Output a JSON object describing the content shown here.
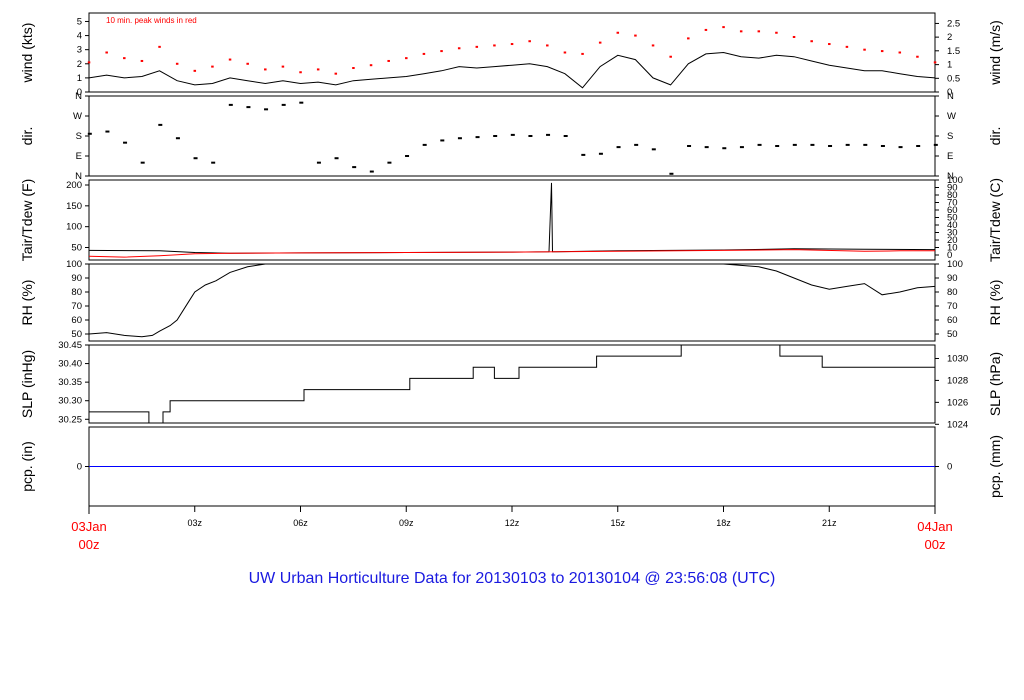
{
  "title": "UW Urban Horticulture Data for 20130103  to  20130104 @ 23:56:08  (UTC)",
  "colors": {
    "line": "#000000",
    "peak": "#ff0000",
    "dew": "#ff0000",
    "precip": "#0000ff",
    "title": "#1a1ae0",
    "endlabel": "#ff0000"
  },
  "x_axis": {
    "range_hours": [
      0,
      24
    ],
    "ticks": [
      {
        "h": 3,
        "label": "03z"
      },
      {
        "h": 6,
        "label": "06z"
      },
      {
        "h": 9,
        "label": "09z"
      },
      {
        "h": 12,
        "label": "12z"
      },
      {
        "h": 15,
        "label": "15z"
      },
      {
        "h": 18,
        "label": "18z"
      },
      {
        "h": 21,
        "label": "21z"
      }
    ],
    "start": {
      "line1": "03Jan",
      "line2": "00z"
    },
    "end": {
      "line1": "04Jan",
      "line2": "00z"
    }
  },
  "chart_data": [
    {
      "id": "wind",
      "type": "line",
      "ylabel": "wind (kts)",
      "ylabel_right": "wind (m/s)",
      "ylim": [
        0,
        5.6
      ],
      "yticks": [
        "0",
        "1",
        "2",
        "3",
        "4",
        "5"
      ],
      "yticks_right": [
        {
          "v": 0,
          "label": "0"
        },
        {
          "v": 0.97,
          "label": "0.5"
        },
        {
          "v": 1.94,
          "label": "1"
        },
        {
          "v": 2.92,
          "label": "1.5"
        },
        {
          "v": 3.89,
          "label": "2"
        },
        {
          "v": 4.86,
          "label": "2.5"
        }
      ],
      "annotation": "10 min. peak winds in red",
      "series": [
        {
          "name": "wind",
          "x": [
            0,
            0.5,
            1,
            1.5,
            2,
            2.5,
            3,
            3.5,
            4,
            4.5,
            5,
            5.5,
            6,
            6.5,
            7,
            7.5,
            8,
            8.5,
            9,
            9.5,
            10,
            10.5,
            11,
            11.5,
            12,
            12.5,
            13,
            13.5,
            14,
            14.5,
            15,
            15.5,
            16,
            16.5,
            17,
            17.5,
            18,
            18.5,
            19,
            19.5,
            20,
            20.5,
            21,
            21.5,
            22,
            22.5,
            23,
            23.5,
            24
          ],
          "values": [
            1,
            1.2,
            1,
            1.1,
            1.5,
            0.8,
            0.5,
            0.6,
            1,
            0.8,
            0.6,
            0.8,
            0.6,
            0.7,
            0.5,
            0.8,
            0.9,
            1,
            1.1,
            1.3,
            1.5,
            1.8,
            1.7,
            1.8,
            1.9,
            2,
            1.8,
            1.3,
            0.3,
            1.8,
            2.6,
            2.3,
            1,
            0.5,
            2,
            2.7,
            2.8,
            2.5,
            2.4,
            2.6,
            2.5,
            2.2,
            1.9,
            1.7,
            1.5,
            1.5,
            1.3,
            1.1,
            1
          ]
        },
        {
          "name": "peak",
          "x": [
            0,
            0.5,
            1,
            1.5,
            2,
            2.5,
            3,
            3.5,
            4,
            4.5,
            5,
            5.5,
            6,
            6.5,
            7,
            7.5,
            8,
            8.5,
            9,
            9.5,
            10,
            10.5,
            11,
            11.5,
            12,
            12.5,
            13,
            13.5,
            14,
            14.5,
            15,
            15.5,
            16,
            16.5,
            17,
            17.5,
            18,
            18.5,
            19,
            19.5,
            20,
            20.5,
            21,
            21.5,
            22,
            22.5,
            23,
            23.5,
            24
          ],
          "values": [
            2.1,
            2.8,
            2.4,
            2.2,
            3.2,
            2,
            1.5,
            1.8,
            2.3,
            2,
            1.6,
            1.8,
            1.4,
            1.6,
            1.3,
            1.7,
            1.9,
            2.2,
            2.4,
            2.7,
            2.9,
            3.1,
            3.2,
            3.3,
            3.4,
            3.6,
            3.3,
            2.8,
            2.7,
            3.5,
            4.2,
            4,
            3.3,
            2.5,
            3.8,
            4.4,
            4.6,
            4.3,
            4.3,
            4.2,
            3.9,
            3.6,
            3.4,
            3.2,
            3,
            2.9,
            2.8,
            2.5,
            2.1
          ]
        }
      ]
    },
    {
      "id": "dir",
      "type": "scatter",
      "ylabel": "dir.",
      "ylabel_right": "dir.",
      "ylim": [
        0,
        360
      ],
      "yticks": [
        {
          "v": 0,
          "label": "N"
        },
        {
          "v": 90,
          "label": "E"
        },
        {
          "v": 180,
          "label": "S"
        },
        {
          "v": 270,
          "label": "W"
        },
        {
          "v": 360,
          "label": "N"
        }
      ],
      "series": [
        {
          "name": "direction",
          "x": [
            0,
            0.5,
            1,
            1.5,
            2,
            2.5,
            3,
            3.5,
            4,
            4.5,
            5,
            5.5,
            6,
            6.5,
            7,
            7.5,
            8,
            8.5,
            9,
            9.5,
            10,
            10.5,
            11,
            11.5,
            12,
            12.5,
            13,
            13.5,
            14,
            14.5,
            15,
            15.5,
            16,
            16.5,
            17,
            17.5,
            18,
            18.5,
            19,
            19.5,
            20,
            20.5,
            21,
            21.5,
            22,
            22.5,
            23,
            23.5,
            24
          ],
          "values": [
            190,
            200,
            150,
            60,
            230,
            170,
            80,
            60,
            320,
            310,
            300,
            320,
            330,
            60,
            80,
            40,
            20,
            60,
            90,
            140,
            160,
            170,
            175,
            180,
            185,
            180,
            185,
            180,
            95,
            100,
            130,
            140,
            120,
            10,
            135,
            130,
            125,
            130,
            140,
            135,
            140,
            140,
            135,
            140,
            140,
            135,
            130,
            135,
            140
          ]
        }
      ]
    },
    {
      "id": "temp",
      "type": "line",
      "ylabel": "Tair/Tdew (F)",
      "ylabel_right": "Tair/Tdew (C)",
      "ylim": [
        20,
        212
      ],
      "yticks": [
        "50",
        "100",
        "150",
        "200"
      ],
      "yticks_right": [
        {
          "v": 32,
          "label": "0"
        },
        {
          "v": 50,
          "label": "10"
        },
        {
          "v": 68,
          "label": "20"
        },
        {
          "v": 86,
          "label": "30"
        },
        {
          "v": 104,
          "label": "40"
        },
        {
          "v": 122,
          "label": "50"
        },
        {
          "v": 140,
          "label": "60"
        },
        {
          "v": 158,
          "label": "70"
        },
        {
          "v": 176,
          "label": "80"
        },
        {
          "v": 194,
          "label": "90"
        },
        {
          "v": 212,
          "label": "100"
        }
      ],
      "series": [
        {
          "name": "Tair",
          "x": [
            0,
            2,
            3,
            4,
            6,
            9,
            12,
            13.05,
            13.12,
            13.15,
            13.25,
            15,
            18,
            20,
            22,
            24
          ],
          "values": [
            43,
            42,
            38,
            36,
            37,
            38,
            39,
            40,
            205,
            40,
            40,
            42,
            44,
            47,
            46,
            45
          ]
        },
        {
          "name": "Tdew",
          "x": [
            0,
            1,
            2,
            3,
            4,
            6,
            9,
            12,
            15,
            18,
            20,
            22,
            23,
            24
          ],
          "values": [
            29,
            27,
            30,
            35,
            36,
            37,
            38,
            39,
            41,
            43,
            45,
            41,
            42,
            42
          ]
        }
      ]
    },
    {
      "id": "rh",
      "type": "line",
      "ylabel": "RH (%)",
      "ylabel_right": "RH (%)",
      "ylim": [
        45,
        100
      ],
      "yticks": [
        "50",
        "60",
        "70",
        "80",
        "90",
        "100"
      ],
      "series": [
        {
          "name": "RH",
          "x": [
            0,
            0.5,
            1,
            1.5,
            1.8,
            2,
            2.3,
            2.5,
            2.8,
            3,
            3.3,
            3.6,
            4,
            4.5,
            5,
            10,
            15,
            18,
            18.5,
            19,
            19.5,
            20,
            20.5,
            21,
            21.5,
            22,
            22.5,
            23,
            23.5,
            24
          ],
          "values": [
            50,
            51,
            49,
            48,
            49,
            52,
            56,
            60,
            72,
            80,
            85,
            88,
            94,
            98,
            100,
            100,
            100,
            100,
            99,
            98,
            95,
            90,
            85,
            82,
            84,
            86,
            78,
            80,
            83,
            84
          ]
        }
      ]
    },
    {
      "id": "slp",
      "type": "line",
      "ylabel": "SLP (inHg)",
      "ylabel_right": "SLP (hPa)",
      "ylim": [
        30.24,
        30.45
      ],
      "yticks": [
        "30.25",
        "30.30",
        "30.35",
        "30.40",
        "30.45"
      ],
      "yticks_right": [
        {
          "v": 30.2365,
          "label": "1024"
        },
        {
          "v": 30.2956,
          "label": "1026"
        },
        {
          "v": 30.3547,
          "label": "1028"
        },
        {
          "v": 30.4137,
          "label": "1030"
        }
      ],
      "series": [
        {
          "name": "SLP",
          "x": [
            0,
            1.7,
            1.7,
            2.1,
            2.1,
            2.3,
            2.3,
            6.1,
            6.1,
            9.1,
            9.1,
            10.9,
            10.9,
            11.5,
            11.5,
            12.2,
            12.2,
            14.4,
            14.4,
            16.8,
            16.8,
            19.6,
            19.6,
            20.8,
            20.8,
            24
          ],
          "values": [
            30.27,
            30.27,
            30.24,
            30.24,
            30.27,
            30.27,
            30.3,
            30.3,
            30.33,
            30.33,
            30.36,
            30.36,
            30.39,
            30.39,
            30.36,
            30.36,
            30.39,
            30.39,
            30.42,
            30.42,
            30.45,
            30.45,
            30.42,
            30.42,
            30.39,
            30.39
          ]
        }
      ]
    },
    {
      "id": "pcp",
      "type": "line",
      "ylabel": "pcp. (in)",
      "ylabel_right": "pcp. (mm)",
      "ylim": [
        -1,
        1
      ],
      "yticks": [
        "0"
      ],
      "yticks_right": [
        {
          "v": 0,
          "label": "0"
        }
      ],
      "series": [
        {
          "name": "precip",
          "x": [
            0,
            24
          ],
          "values": [
            0,
            0
          ]
        }
      ]
    }
  ]
}
